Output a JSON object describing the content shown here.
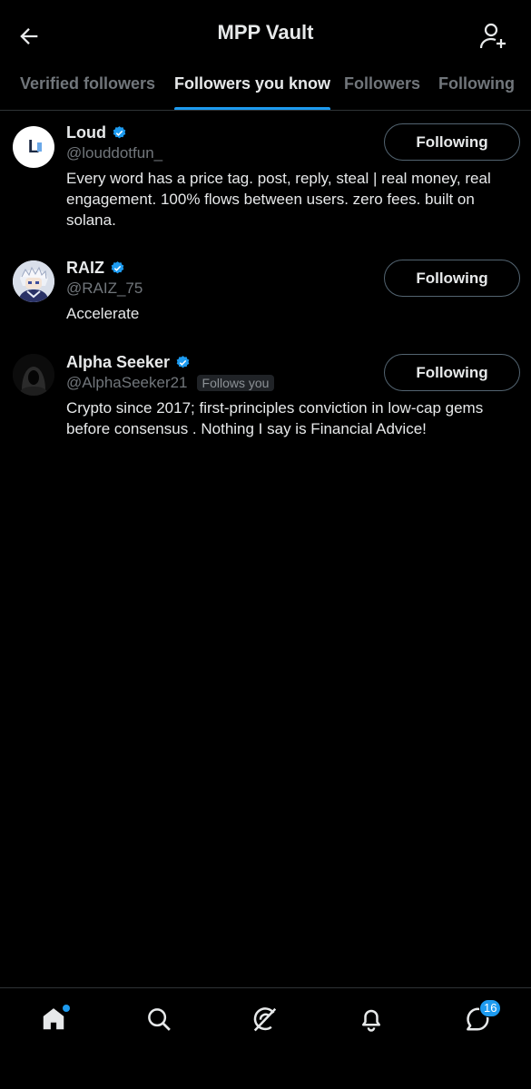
{
  "header": {
    "title": "MPP Vault",
    "back_icon": "arrow-left-icon",
    "add_user_icon": "person-plus-icon"
  },
  "tabs": [
    {
      "label": "Verified followers",
      "active": false
    },
    {
      "label": "Followers you know",
      "active": true
    },
    {
      "label": "Followers",
      "active": false
    },
    {
      "label": "Following",
      "active": false
    }
  ],
  "users": [
    {
      "name": "Loud",
      "handle": "@louddotfun_",
      "verified": true,
      "follows_you": "",
      "bio": "Every word has a price tag. post, reply, steal | real money, real engagement. 100% flows between users. zero fees. built on solana.",
      "button_label": "Following",
      "avatar_letter": "L"
    },
    {
      "name": "RAIZ",
      "handle": "@RAIZ_75",
      "verified": true,
      "follows_you": "",
      "bio": "Accelerate",
      "button_label": "Following"
    },
    {
      "name": "Alpha Seeker",
      "handle": "@AlphaSeeker21",
      "verified": true,
      "follows_you": "Follows you",
      "bio": "Crypto since 2017; first-principles conviction in low-cap gems before consensus . Nothing I say is Financial Advice!",
      "button_label": "Following"
    }
  ],
  "bottom_nav": {
    "items": [
      "home-icon",
      "search-icon",
      "grok-icon",
      "bell-icon",
      "messages-icon"
    ],
    "messages_count": "16",
    "accent": "#1d9bf0"
  }
}
